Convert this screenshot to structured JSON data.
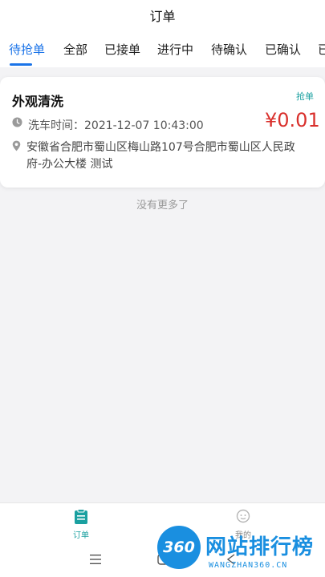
{
  "header": {
    "title": "订单"
  },
  "tabs": [
    {
      "label": "待抢单",
      "active": true
    },
    {
      "label": "全部"
    },
    {
      "label": "已接单"
    },
    {
      "label": "进行中"
    },
    {
      "label": "待确认"
    },
    {
      "label": "已确认"
    },
    {
      "label": "已"
    }
  ],
  "order": {
    "title": "外观清洗",
    "tag": "抢单",
    "time_label": "洗车时间：2021-12-07 10:43:00",
    "price": "¥0.01",
    "address": "安徽省合肥市蜀山区梅山路107号合肥市蜀山区人民政府-办公大楼 测试"
  },
  "list": {
    "no_more": "没有更多了"
  },
  "tabbar": {
    "items": [
      {
        "label": "订单",
        "icon": "clipboard-icon",
        "active": true
      },
      {
        "label": "我的",
        "icon": "user-icon",
        "active": false
      }
    ]
  },
  "system_nav": {
    "icons": [
      "menu-icon",
      "home-icon",
      "back-icon"
    ]
  },
  "watermark": {
    "logo": "360",
    "title": "网站排行榜",
    "subtitle": "WANGZHAN360.CN"
  },
  "colors": {
    "accent": "#1a73e8",
    "price": "#d9302c",
    "tag": "#1aa0a0",
    "brand": "#1a8fe0"
  }
}
